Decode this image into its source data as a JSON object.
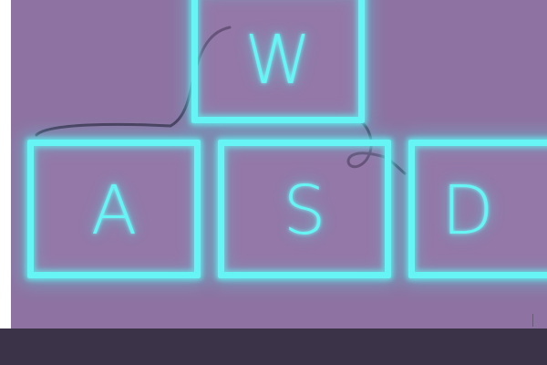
{
  "keys": {
    "w": {
      "label": "W"
    },
    "a": {
      "label": "A"
    },
    "s": {
      "label": "S"
    },
    "d": {
      "label": "D"
    }
  },
  "colors": {
    "background": "#8e73a2",
    "glow": "#67f4f4",
    "bottom_bar": "#3b3348",
    "doodle": "#4a3d5c"
  }
}
